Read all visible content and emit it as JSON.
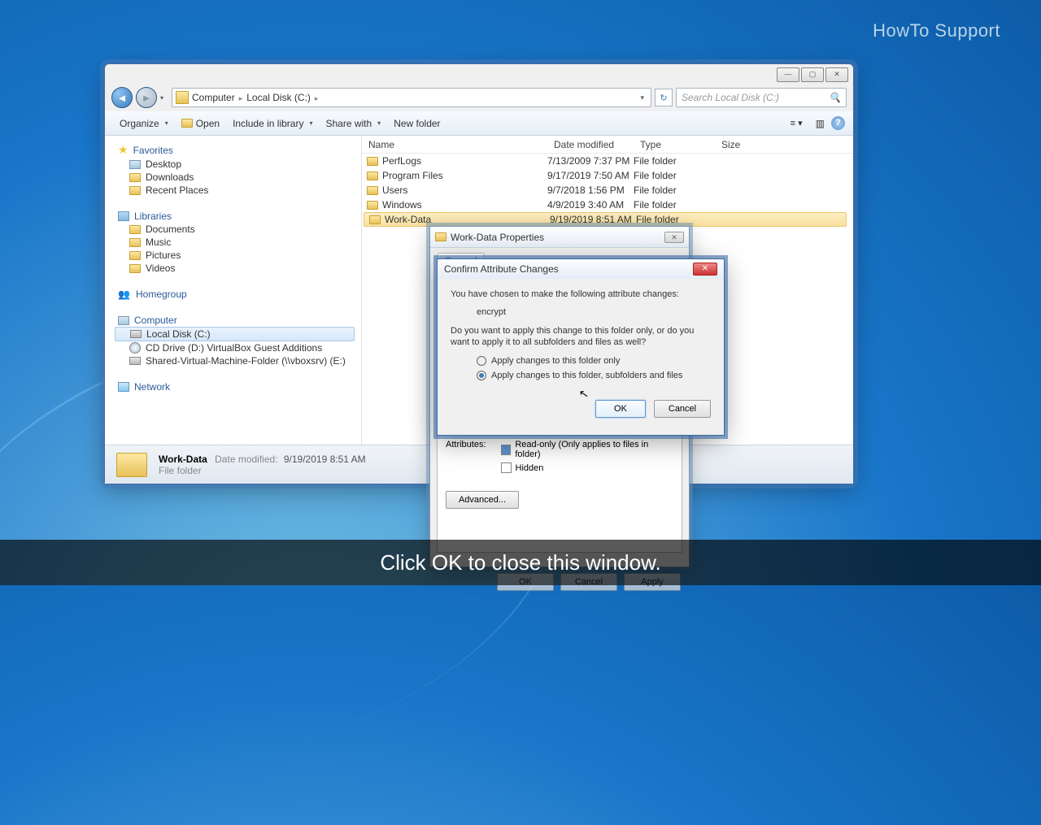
{
  "watermark": "HowTo Support",
  "subtitle": "Click OK to close this window.",
  "breadcrumbs": {
    "root": "Computer",
    "drive": "Local Disk (C:)"
  },
  "search": {
    "placeholder": "Search Local Disk (C:)"
  },
  "toolbar": {
    "organize": "Organize",
    "open": "Open",
    "include": "Include in library",
    "share": "Share with",
    "newfolder": "New folder"
  },
  "sidebar": {
    "favorites": {
      "head": "Favorites",
      "items": [
        "Desktop",
        "Downloads",
        "Recent Places"
      ]
    },
    "libraries": {
      "head": "Libraries",
      "items": [
        "Documents",
        "Music",
        "Pictures",
        "Videos"
      ]
    },
    "homegroup": "Homegroup",
    "computer": {
      "head": "Computer",
      "items": [
        "Local Disk (C:)",
        "CD Drive (D:) VirtualBox Guest Additions",
        "Shared-Virtual-Machine-Folder (\\\\vboxsrv) (E:)"
      ]
    },
    "network": "Network"
  },
  "columns": {
    "name": "Name",
    "date": "Date modified",
    "type": "Type",
    "size": "Size"
  },
  "files": [
    {
      "name": "PerfLogs",
      "date": "7/13/2009 7:37 PM",
      "type": "File folder"
    },
    {
      "name": "Program Files",
      "date": "9/17/2019 7:50 AM",
      "type": "File folder"
    },
    {
      "name": "Users",
      "date": "9/7/2018 1:56 PM",
      "type": "File folder"
    },
    {
      "name": "Windows",
      "date": "4/9/2019 3:40 AM",
      "type": "File folder"
    },
    {
      "name": "Work-Data",
      "date": "9/19/2019 8:51 AM",
      "type": "File folder"
    }
  ],
  "status": {
    "name": "Work-Data",
    "date_lbl": "Date modified:",
    "date": "9/19/2019 8:51 AM",
    "type": "File folder"
  },
  "props": {
    "title": "Work-Data Properties",
    "attributes": "Attributes:",
    "readonly": "Read-only (Only applies to files in folder)",
    "hidden": "Hidden",
    "advanced": "Advanced...",
    "ok": "OK",
    "cancel": "Cancel",
    "apply": "Apply"
  },
  "confirm": {
    "title": "Confirm Attribute Changes",
    "line1": "You have chosen to make the following attribute changes:",
    "change": "encrypt",
    "line2": "Do you want to apply this change to this folder only, or do you want to apply it to all subfolders and files as well?",
    "opt1": "Apply changes to this folder only",
    "opt2": "Apply changes to this folder, subfolders and files",
    "ok": "OK",
    "cancel": "Cancel"
  }
}
